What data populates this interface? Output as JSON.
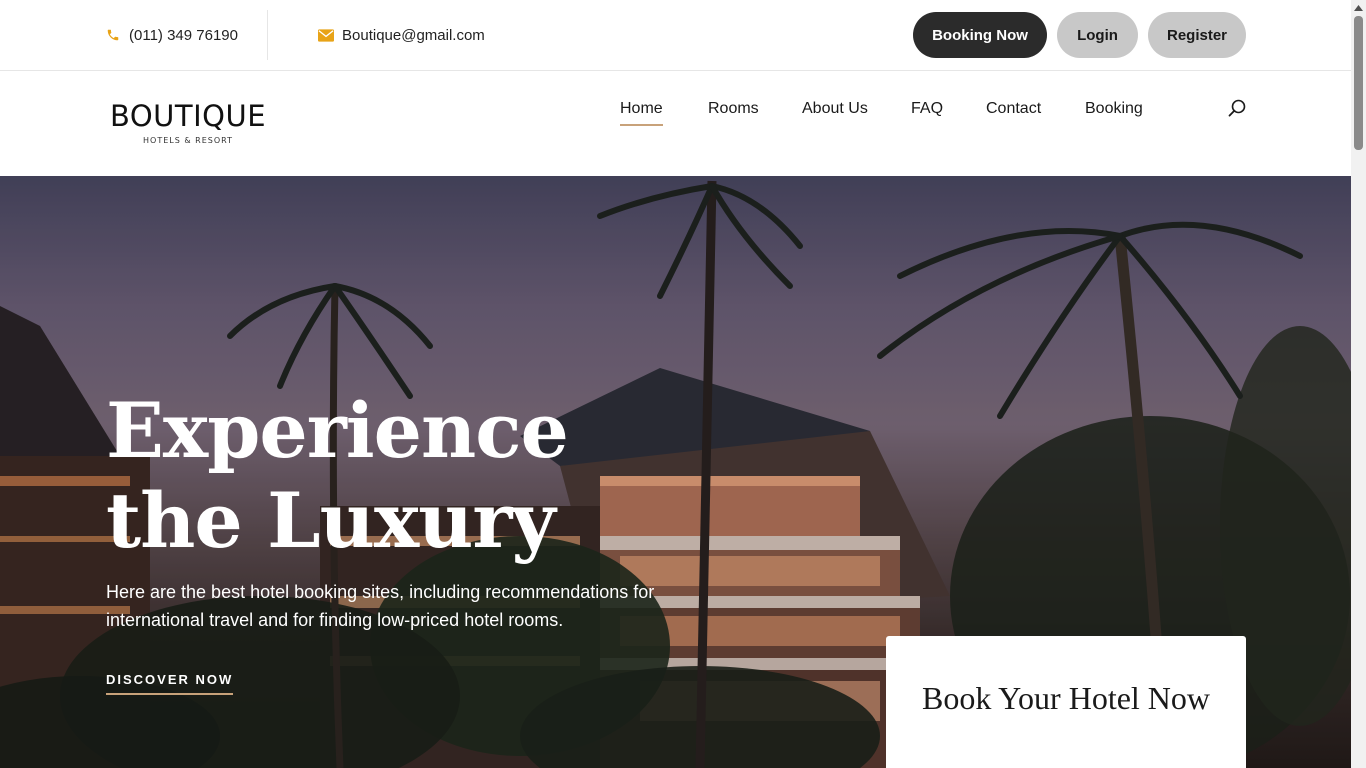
{
  "topbar": {
    "phone": "(011) 349 76190",
    "email": "Boutique@gmail.com",
    "icons": {
      "phone": "phone-icon",
      "email": "envelope-icon"
    },
    "accent_color": "#e8a317",
    "booking_label": "Booking Now",
    "login_label": "Login",
    "register_label": "Register"
  },
  "brand": {
    "name": "BOUTIQUE",
    "tagline": "HOTELS & RESORT"
  },
  "nav": {
    "items": [
      {
        "label": "Home",
        "active": true
      },
      {
        "label": "Rooms"
      },
      {
        "label": "About Us"
      },
      {
        "label": "FAQ"
      },
      {
        "label": "Contact"
      },
      {
        "label": "Booking"
      }
    ],
    "search_icon": "search-icon",
    "underline_color": "#c8a27a"
  },
  "hero": {
    "title_line1": "Experience",
    "title_line2": "the Luxury",
    "text": "Here are the best hotel booking sites, including recommendations for international travel and for finding low-priced hotel rooms.",
    "cta_label": "DISCOVER NOW",
    "card_title": "Book Your Hotel Now"
  }
}
